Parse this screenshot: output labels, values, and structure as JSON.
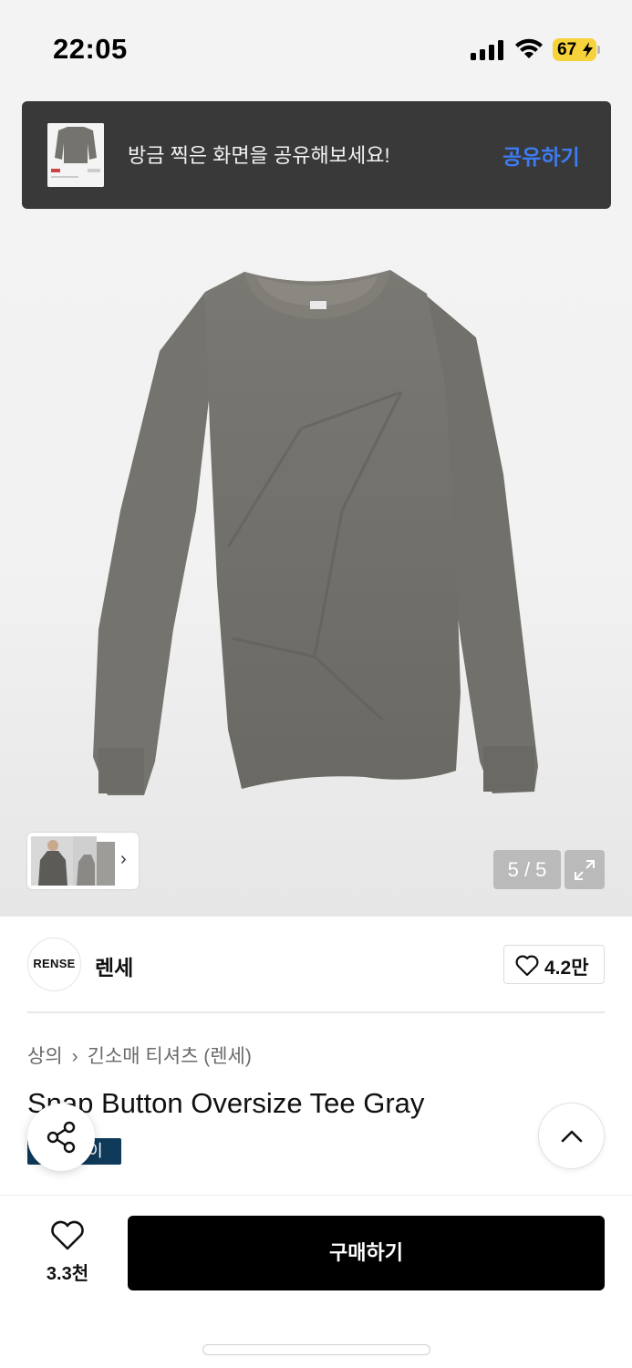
{
  "status_bar": {
    "time": "22:05",
    "battery": "67",
    "icons": [
      "cellular-signal-icon",
      "wifi-icon",
      "battery-charging-icon"
    ]
  },
  "share_toast": {
    "message": "방금 찍은 화면을 공유해보세요!",
    "action": "공유하기",
    "action_color": "#3d7bf0"
  },
  "gallery": {
    "counter": "5 / 5",
    "thumbnail_more_icon": "chevron-right-icon",
    "expand_icon": "expand-icon"
  },
  "brand": {
    "logo_text": "RENSE",
    "name": "렌세",
    "likes": "4.2만"
  },
  "breadcrumb": {
    "category": "상의",
    "subcategory": "긴소매 티셔츠 (렌세)"
  },
  "product": {
    "title": "Snap Button Oversize Tee Gray",
    "tag": "그레이"
  },
  "bottom_bar": {
    "like_count": "3.3천",
    "buy_label": "구매하기"
  },
  "colors": {
    "toast_bg": "#393939",
    "tag_bg": "#0f3a5a",
    "buy_bg": "#000000",
    "battery": "#f6d23b"
  }
}
